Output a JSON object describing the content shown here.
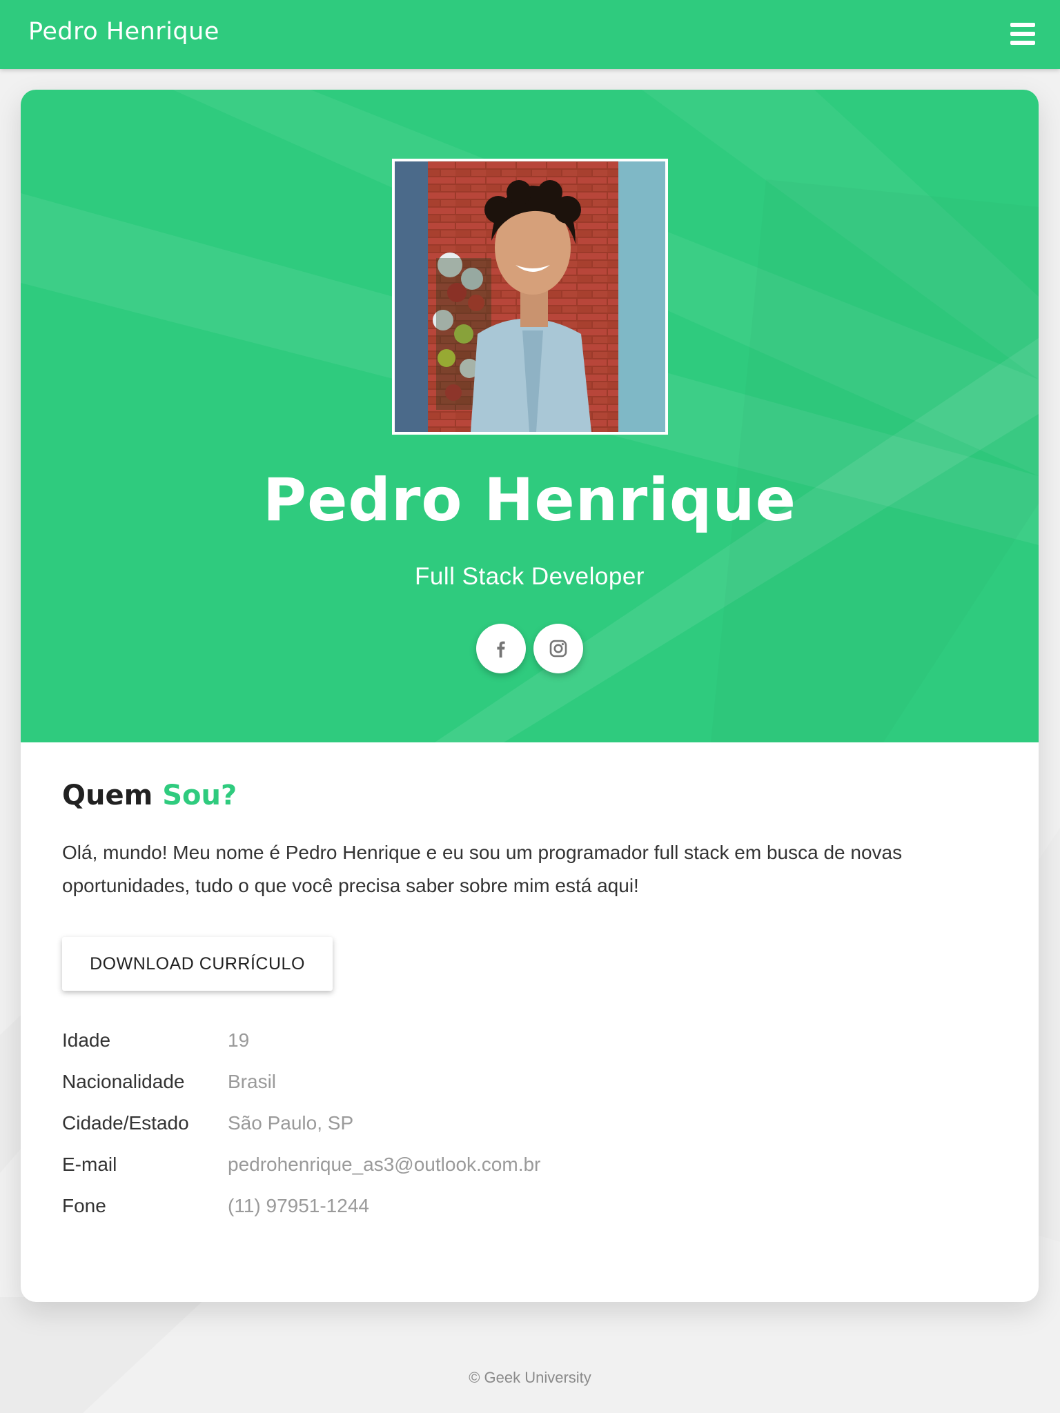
{
  "navbar": {
    "brand": "Pedro Henrique",
    "menu_icon": "hamburger-menu-icon",
    "background": "#2fcb7e"
  },
  "hero": {
    "name": "Pedro Henrique",
    "role": "Full Stack Developer",
    "social": [
      {
        "icon": "facebook-icon"
      },
      {
        "icon": "instagram-icon"
      }
    ]
  },
  "about": {
    "title_part1": "Quem",
    "title_part2": "Sou?",
    "text": "Olá, mundo! Meu nome é Pedro Henrique e eu sou um programador full stack em busca de novas oportunidades, tudo o que você precisa saber sobre mim está aqui!",
    "download_label": "DOWNLOAD CURRÍCULO"
  },
  "info": [
    {
      "label": "Idade",
      "value": "19"
    },
    {
      "label": "Nacionalidade",
      "value": "Brasil"
    },
    {
      "label": "Cidade/Estado",
      "value": "São Paulo, SP"
    },
    {
      "label": "E-mail",
      "value": "pedrohenrique_as3@outlook.com.br"
    },
    {
      "label": "Fone",
      "value": "(11) 97951-1244"
    }
  ],
  "footer": {
    "text": "© Geek University"
  },
  "colors": {
    "accent": "#2fcb7e",
    "text_dark": "#212121",
    "text_muted": "#9a9a9a"
  }
}
